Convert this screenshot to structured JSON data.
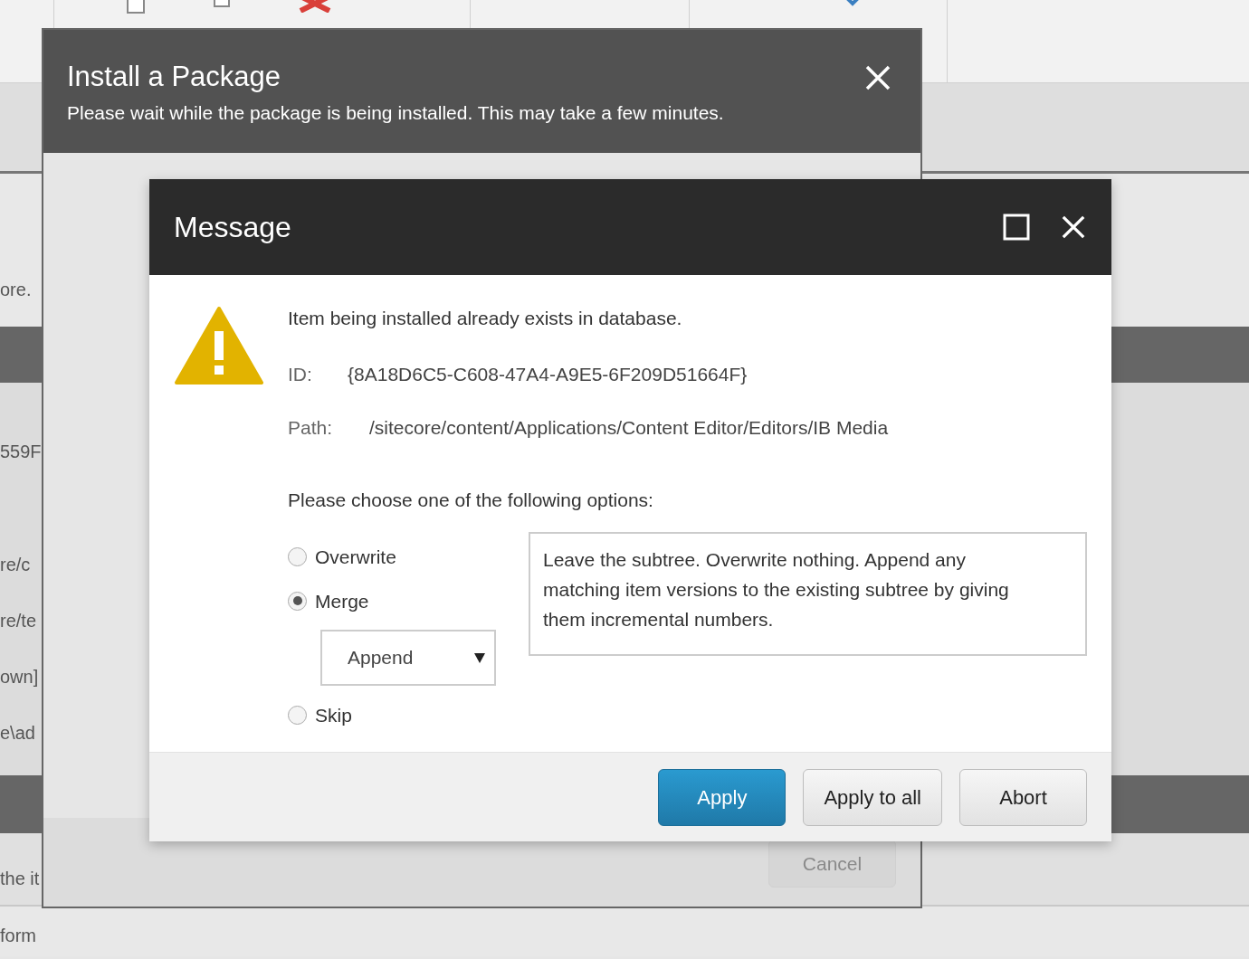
{
  "background": {
    "left_fragments": [
      "ore.",
      "559F",
      "re/c",
      "re/te",
      "own]",
      "e\\ad",
      "the it",
      "form"
    ]
  },
  "install_dialog": {
    "title": "Install a Package",
    "subtitle": "Please wait while the package is being installed. This may take a few minutes.",
    "cancel_button": {
      "label": "Cancel",
      "disabled": true
    }
  },
  "message_dialog": {
    "title": "Message",
    "message": "Item being installed already exists in database.",
    "id_label": "ID:",
    "id_value": "{8A18D6C5-C608-47A4-A9E5-6F209D51664F}",
    "path_label": "Path:",
    "path_value": "/sitecore/content/Applications/Content Editor/Editors/IB Media",
    "prompt": "Please choose one of the following options:",
    "options": [
      {
        "label": "Overwrite",
        "selected": false
      },
      {
        "label": "Merge",
        "selected": true,
        "dropdown": "Append"
      },
      {
        "label": "Skip",
        "selected": false
      }
    ],
    "description": "Leave the subtree. Overwrite nothing. Append any matching item versions to the existing subtree by giving them incremental numbers.",
    "buttons": [
      {
        "label": "Apply",
        "primary": true
      },
      {
        "label": "Apply to all",
        "primary": false
      },
      {
        "label": "Abort",
        "primary": false
      }
    ]
  }
}
